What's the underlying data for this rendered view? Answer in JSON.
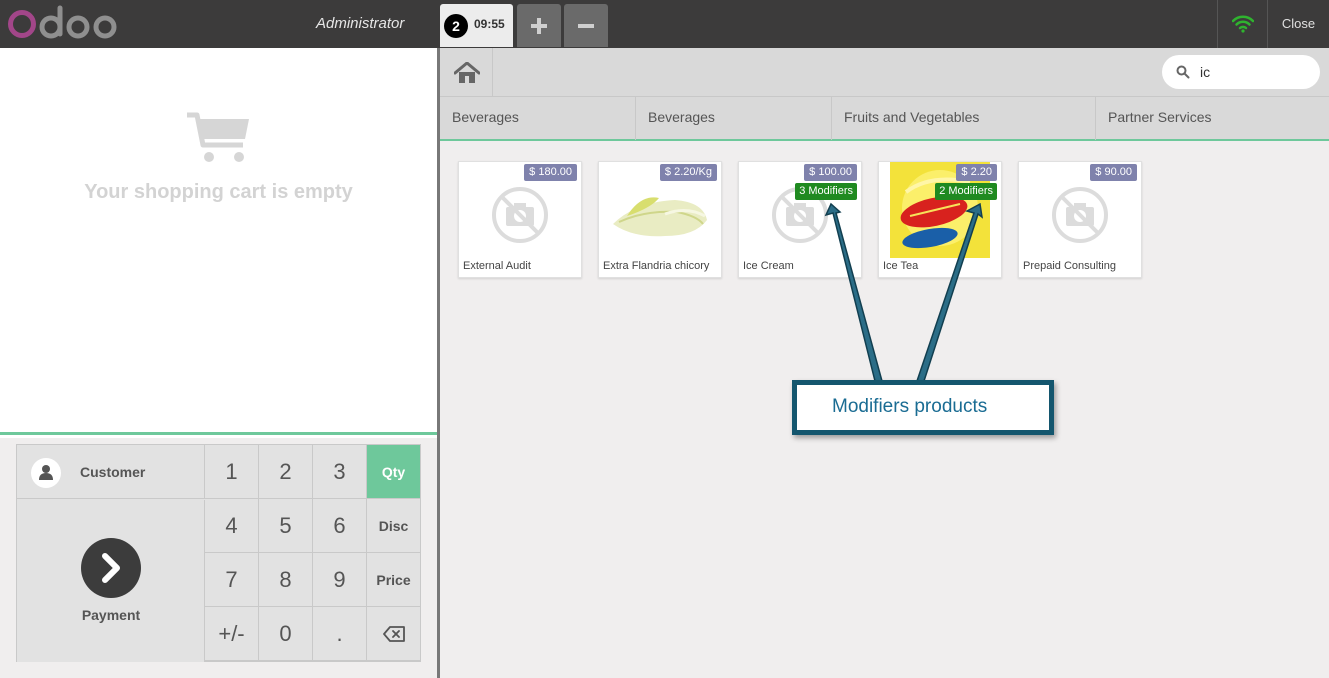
{
  "topbar": {
    "logo_text": "odoo",
    "user_name": "Administrator",
    "order_number": "2",
    "order_time": "09:55",
    "add_order_icon": "plus-icon",
    "remove_order_icon": "minus-icon",
    "connection_icon": "wifi-icon",
    "close_label": "Close"
  },
  "cart": {
    "icon": "shopping-cart-icon",
    "empty_message": "Your shopping cart is empty"
  },
  "numpad": {
    "customer_label": "Customer",
    "payment_label": "Payment",
    "keys": [
      "1",
      "2",
      "3",
      "4",
      "5",
      "6",
      "7",
      "8",
      "9",
      "+/-",
      "0",
      "."
    ],
    "modes": [
      "Qty",
      "Disc",
      "Price"
    ],
    "active_mode": "Qty",
    "backspace_icon": "backspace-icon"
  },
  "search": {
    "icon": "search-icon",
    "value": "ic"
  },
  "categories": [
    "Beverages",
    "Beverages",
    "Fruits and Vegetables",
    "Partner Services"
  ],
  "products": [
    {
      "name": "External Audit",
      "price": "$ 180.00",
      "modifiers": "",
      "image": "no-image"
    },
    {
      "name": "Extra Flandria chicory",
      "price": "$ 2.20/Kg",
      "modifiers": "",
      "image": "chicory"
    },
    {
      "name": "Ice Cream",
      "price": "$ 100.00",
      "modifiers": "3 Modifiers",
      "image": "no-image"
    },
    {
      "name": "Ice Tea",
      "price": "$ 2.20",
      "modifiers": "2 Modifiers",
      "image": "lipton-ice-tea"
    },
    {
      "name": "Prepaid Consulting",
      "price": "$ 90.00",
      "modifiers": "",
      "image": "no-image"
    }
  ],
  "annotation": {
    "text": "Modifiers products"
  },
  "colors": {
    "topbar": "#3c3b3b",
    "accent": "#6ec89b",
    "price_tag": "#7f82ac",
    "modifier_tag": "#1f8a20",
    "annotation_border": "#14566e",
    "annotation_text": "#1a6c93"
  }
}
